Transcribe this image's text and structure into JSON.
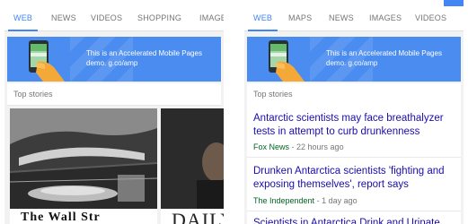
{
  "left_screen": {
    "tabs": [
      {
        "label": "WEB",
        "active": true
      },
      {
        "label": "NEWS",
        "active": false
      },
      {
        "label": "VIDEOS",
        "active": false
      },
      {
        "label": "SHOPPING",
        "active": false
      },
      {
        "label": "IMAGES",
        "active": false
      }
    ],
    "banner_text": "This is an Accelerated Mobile Pages demo. g.co/amp",
    "top_stories_label": "Top stories",
    "cards": [
      {
        "title_partial": "The Wall Str"
      },
      {
        "title_partial": "DAILY"
      }
    ]
  },
  "right_screen": {
    "tabs": [
      {
        "label": "WEB",
        "active": true
      },
      {
        "label": "MAPS",
        "active": false
      },
      {
        "label": "NEWS",
        "active": false
      },
      {
        "label": "IMAGES",
        "active": false
      },
      {
        "label": "VIDEOS",
        "active": false
      }
    ],
    "banner_text": "This is an Accelerated Mobile Pages demo. g.co/amp",
    "top_stories_label": "Top stories",
    "stories": [
      {
        "headline": "Antarctic scientists may face breathalyzer tests in attempt to curb drunkenness",
        "source": "Fox News",
        "time": "- 22 hours ago"
      },
      {
        "headline": "Drunken Antarctica scientists 'fighting and exposing themselves', report says",
        "source": "The Independent",
        "time": "- 1 day ago"
      },
      {
        "headline": "Scientists in Antarctica Drink and Urinate",
        "source": "",
        "time": ""
      }
    ]
  },
  "colors": {
    "accent_blue": "#4285f4",
    "banner_blue": "#4a8cf0",
    "link_blue": "#1a0dab",
    "source_green": "#006621"
  }
}
